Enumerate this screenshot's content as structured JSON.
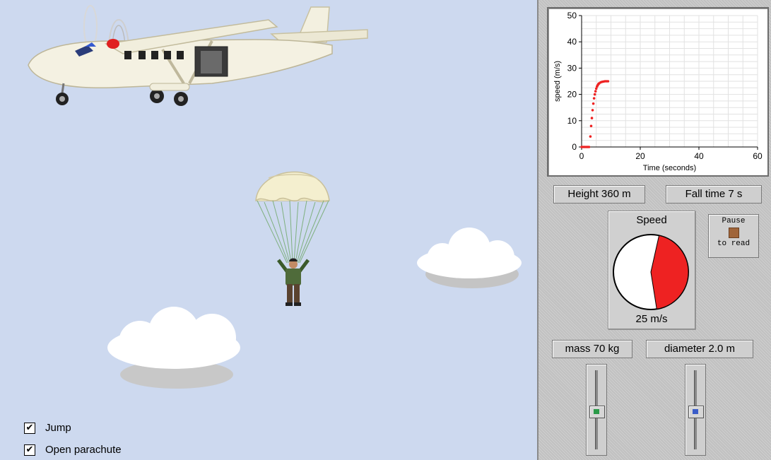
{
  "controls": {
    "jump_label": "Jump",
    "jump_checked": true,
    "open_parachute_label": "Open parachute",
    "open_parachute_checked": true
  },
  "readouts": {
    "height": "Height 360 m",
    "fall_time": "Fall time  7 s",
    "mass": "mass 70 kg",
    "diameter": "diameter 2.0 m"
  },
  "speedometer": {
    "title": "Speed",
    "value_text": "25 m/s",
    "speed_fraction": 0.44,
    "color": "#ee2222"
  },
  "pause_button": {
    "line1": "Pause",
    "line2": "to read",
    "icon_color": "#a0653a"
  },
  "sliders": {
    "mass_level": 0.5,
    "mass_color": "#2a9a48",
    "diameter_level": 0.5,
    "diameter_color": "#3a5cc8"
  },
  "chart_data": {
    "type": "scatter",
    "xlabel": "Time (seconds)",
    "ylabel": "speed (m/s)",
    "xlim": [
      0,
      60
    ],
    "ylim": [
      0,
      50
    ],
    "xticks": [
      0,
      20,
      40,
      60
    ],
    "yticks": [
      0,
      10,
      20,
      30,
      40,
      50
    ],
    "grid": true,
    "series": [
      {
        "color": "#ee2222",
        "x": [
          0,
          0.5,
          1,
          1.5,
          2,
          2.5,
          3,
          3.25,
          3.5,
          3.75,
          4,
          4.25,
          4.5,
          4.75,
          5,
          5.25,
          5.5,
          5.75,
          6,
          6.5,
          7,
          7.5,
          8,
          8.5,
          9
        ],
        "y": [
          0,
          0,
          0,
          0,
          0,
          0,
          4,
          8,
          11,
          14,
          16.5,
          18.5,
          20,
          21.2,
          22.2,
          23,
          23.5,
          24,
          24.2,
          24.6,
          24.8,
          24.9,
          25,
          25,
          25
        ]
      }
    ]
  }
}
